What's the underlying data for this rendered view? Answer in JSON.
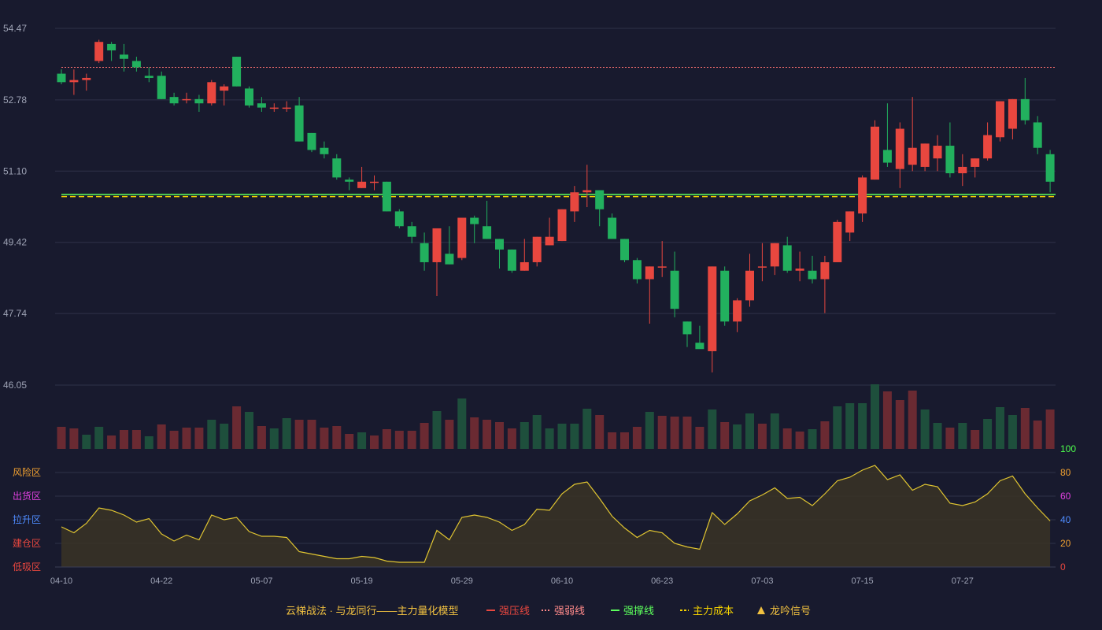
{
  "chart_data": {
    "type": "candlestick",
    "price_axis": {
      "ticks": [
        "54.47",
        "52.78",
        "51.10",
        "49.42",
        "47.74",
        "46.05"
      ],
      "range": [
        46.05,
        54.47
      ]
    },
    "x_ticks": [
      {
        "label": "04-10",
        "index": 0
      },
      {
        "label": "04-22",
        "index": 8
      },
      {
        "label": "05-07",
        "index": 16
      },
      {
        "label": "05-19",
        "index": 24
      },
      {
        "label": "05-29",
        "index": 32
      },
      {
        "label": "06-10",
        "index": 40
      },
      {
        "label": "06-23",
        "index": 48
      },
      {
        "label": "07-03",
        "index": 56
      },
      {
        "label": "07-15",
        "index": 64
      },
      {
        "label": "07-27",
        "index": 72
      }
    ],
    "candles": [
      [
        53.4,
        53.2,
        53.5,
        53.15
      ],
      [
        53.2,
        53.25,
        53.5,
        52.9
      ],
      [
        53.25,
        53.3,
        53.4,
        53.0
      ],
      [
        53.7,
        54.15,
        54.2,
        53.65
      ],
      [
        54.1,
        53.95,
        54.15,
        53.7
      ],
      [
        53.85,
        53.75,
        54.1,
        53.45
      ],
      [
        53.7,
        53.55,
        53.8,
        53.45
      ],
      [
        53.35,
        53.3,
        53.55,
        53.2
      ],
      [
        53.35,
        52.8,
        53.45,
        52.8
      ],
      [
        52.85,
        52.7,
        52.95,
        52.65
      ],
      [
        52.8,
        52.8,
        52.95,
        52.7
      ],
      [
        52.8,
        52.7,
        52.9,
        52.5
      ],
      [
        52.7,
        53.2,
        53.25,
        52.65
      ],
      [
        53.0,
        53.1,
        53.15,
        52.65
      ],
      [
        53.8,
        53.1,
        53.8,
        53.1
      ],
      [
        53.05,
        52.65,
        53.1,
        52.6
      ],
      [
        52.7,
        52.6,
        52.85,
        52.5
      ],
      [
        52.6,
        52.6,
        52.7,
        52.5
      ],
      [
        52.6,
        52.6,
        52.75,
        52.5
      ],
      [
        52.65,
        51.8,
        52.85,
        51.8
      ],
      [
        52.0,
        51.6,
        52.0,
        51.55
      ],
      [
        51.65,
        51.5,
        51.8,
        51.4
      ],
      [
        51.4,
        50.95,
        51.5,
        50.9
      ],
      [
        50.9,
        50.85,
        50.95,
        50.65
      ],
      [
        50.7,
        50.85,
        51.2,
        50.7
      ],
      [
        50.85,
        50.85,
        51.0,
        50.65
      ],
      [
        50.85,
        50.15,
        50.85,
        50.15
      ],
      [
        50.15,
        49.8,
        50.2,
        49.75
      ],
      [
        49.8,
        49.55,
        49.9,
        49.4
      ],
      [
        49.4,
        48.95,
        49.65,
        48.75
      ],
      [
        48.95,
        49.75,
        49.75,
        48.15
      ],
      [
        49.15,
        48.9,
        49.8,
        48.9
      ],
      [
        49.05,
        50.0,
        50.0,
        49.0
      ],
      [
        50.0,
        49.85,
        50.05,
        49.4
      ],
      [
        49.8,
        49.5,
        50.4,
        49.5
      ],
      [
        49.5,
        49.25,
        49.5,
        48.8
      ],
      [
        49.25,
        48.75,
        49.25,
        48.7
      ],
      [
        48.75,
        48.95,
        49.5,
        48.75
      ],
      [
        48.95,
        49.55,
        49.55,
        48.85
      ],
      [
        49.35,
        49.55,
        50.0,
        49.35
      ],
      [
        49.45,
        50.2,
        50.2,
        49.45
      ],
      [
        50.15,
        50.6,
        50.75,
        49.9
      ],
      [
        50.6,
        50.65,
        51.25,
        50.25
      ],
      [
        50.65,
        50.2,
        50.65,
        49.8
      ],
      [
        50.0,
        49.5,
        50.1,
        49.5
      ],
      [
        49.5,
        49.0,
        49.5,
        48.95
      ],
      [
        49.0,
        48.55,
        49.05,
        48.45
      ],
      [
        48.55,
        48.85,
        48.85,
        47.5
      ],
      [
        48.85,
        48.85,
        49.45,
        48.6
      ],
      [
        48.75,
        47.85,
        49.2,
        47.65
      ],
      [
        47.55,
        47.25,
        47.55,
        46.95
      ],
      [
        47.05,
        46.9,
        47.45,
        46.95
      ],
      [
        46.85,
        48.85,
        48.85,
        46.35
      ],
      [
        48.75,
        47.55,
        48.85,
        47.45
      ],
      [
        47.55,
        48.05,
        48.1,
        47.3
      ],
      [
        48.05,
        48.75,
        49.15,
        47.9
      ],
      [
        48.85,
        48.85,
        49.4,
        48.5
      ],
      [
        48.85,
        49.4,
        49.4,
        48.65
      ],
      [
        49.35,
        48.75,
        49.55,
        48.7
      ],
      [
        48.75,
        48.8,
        49.2,
        48.5
      ],
      [
        48.75,
        48.55,
        49.1,
        48.45
      ],
      [
        48.55,
        48.95,
        49.1,
        47.75
      ],
      [
        48.95,
        49.9,
        49.95,
        48.95
      ],
      [
        49.65,
        50.15,
        50.15,
        49.45
      ],
      [
        50.1,
        50.95,
        51.0,
        49.9
      ],
      [
        50.9,
        52.15,
        52.3,
        50.9
      ],
      [
        51.6,
        51.3,
        52.7,
        51.2
      ],
      [
        51.15,
        52.1,
        52.25,
        50.7
      ],
      [
        51.25,
        51.65,
        52.85,
        51.1
      ],
      [
        51.2,
        51.75,
        51.75,
        51.1
      ],
      [
        51.4,
        51.7,
        51.95,
        51.1
      ],
      [
        51.7,
        51.05,
        52.25,
        50.95
      ],
      [
        51.05,
        51.2,
        51.5,
        50.75
      ],
      [
        51.2,
        51.4,
        51.4,
        50.95
      ],
      [
        51.4,
        51.95,
        52.25,
        51.35
      ],
      [
        51.9,
        52.75,
        52.75,
        51.8
      ],
      [
        52.1,
        52.8,
        52.8,
        51.85
      ],
      [
        52.8,
        52.3,
        53.3,
        52.2
      ],
      [
        52.25,
        51.65,
        52.4,
        51.5
      ],
      [
        51.5,
        50.85,
        51.6,
        50.6
      ]
    ],
    "volumes": [
      28,
      26,
      18,
      28,
      17,
      24,
      24,
      16,
      31,
      23,
      27,
      27,
      37,
      32,
      54,
      47,
      29,
      26,
      39,
      37,
      37,
      27,
      29,
      19,
      21,
      17,
      25,
      23,
      23,
      33,
      48,
      37,
      64,
      40,
      37,
      34,
      26,
      34,
      43,
      26,
      32,
      32,
      51,
      43,
      21,
      21,
      28,
      47,
      42,
      41,
      41,
      28,
      50,
      34,
      31,
      45,
      32,
      45,
      26,
      22,
      25,
      35,
      54,
      58,
      58,
      82,
      73,
      62,
      74,
      50,
      33,
      27,
      33,
      24,
      38,
      53,
      43,
      52,
      36,
      50
    ],
    "bull_vol_flags": [
      0,
      0,
      1,
      1,
      0,
      0,
      0,
      1,
      0,
      0,
      0,
      0,
      1,
      1,
      0,
      1,
      0,
      1,
      1,
      0,
      0,
      0,
      0,
      0,
      1,
      0,
      0,
      0,
      0,
      0,
      1,
      0,
      1,
      0,
      0,
      0,
      0,
      1,
      1,
      1,
      1,
      1,
      1,
      0,
      0,
      0,
      0,
      1,
      0,
      0,
      0,
      0,
      1,
      0,
      1,
      1,
      0,
      1,
      0,
      0,
      1,
      0,
      1,
      1,
      1,
      1,
      0,
      0,
      0,
      1,
      1,
      0,
      1,
      0,
      1,
      1,
      1,
      0,
      0,
      0
    ],
    "oscillator": [
      34,
      29,
      37,
      50,
      48,
      44,
      38,
      41,
      28,
      22,
      27,
      23,
      44,
      40,
      42,
      30,
      26,
      26,
      25,
      13,
      11,
      9,
      7,
      7,
      9,
      8,
      5,
      4,
      4,
      4,
      31,
      23,
      42,
      44,
      42,
      38,
      31,
      36,
      49,
      48,
      62,
      70,
      72,
      58,
      43,
      33,
      25,
      31,
      29,
      20,
      17,
      15,
      46,
      36,
      45,
      56,
      61,
      67,
      58,
      59,
      52,
      62,
      73,
      76,
      82,
      86,
      74,
      78,
      65,
      70,
      68,
      54,
      52,
      55,
      62,
      73,
      77,
      62,
      50,
      39
    ],
    "osc_axis": {
      "ticks": [
        "100",
        "80",
        "60",
        "40",
        "20",
        "0"
      ]
    },
    "zones": [
      "风险区",
      "出货区",
      "拉升区",
      "建仓区",
      "低吸区"
    ],
    "levels": {
      "resistance_dashed": 53.55,
      "support": 50.55,
      "cost": 50.5
    }
  },
  "legend": {
    "title": "云梯战法 · 与龙同行——主力量化模型",
    "items": [
      {
        "label": "强压线",
        "color": "#e8473f",
        "style": "solid"
      },
      {
        "label": "强弱线",
        "color": "#ff8a8a",
        "style": "dotted"
      },
      {
        "label": "强撑线",
        "color": "#5cff5c",
        "style": "solid"
      },
      {
        "label": "主力成本",
        "color": "#f5d200",
        "style": "dashed"
      },
      {
        "label": "龙吟信号",
        "color": "#f0c040",
        "style": "triangle"
      }
    ]
  },
  "colors": {
    "up": "#e8473f",
    "down": "#22b05e",
    "grid": "#2e3148",
    "osc": "#e0c531",
    "zone_colors": [
      "#f0a030",
      "#e040e0",
      "#4f8cff",
      "#e8473f",
      "#e8473f"
    ],
    "osc_tick_colors": [
      "#4dff4d",
      "#f0a030",
      "#e040e0",
      "#4f8cff",
      "#f0a030",
      "#e8473f"
    ]
  }
}
